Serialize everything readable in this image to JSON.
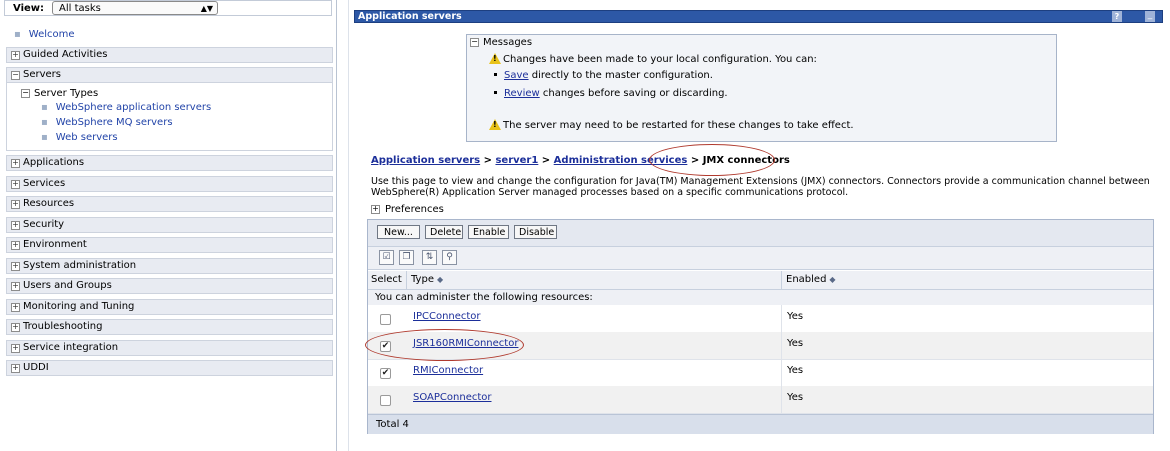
{
  "nav": {
    "view_label": "View:",
    "view_value": "All tasks",
    "welcome": "Welcome",
    "items": [
      {
        "label": "Guided Activities",
        "state": "+"
      },
      {
        "label": "Servers",
        "state": "−"
      },
      {
        "label": "Applications",
        "state": "+"
      },
      {
        "label": "Services",
        "state": "+"
      },
      {
        "label": "Resources",
        "state": "+"
      },
      {
        "label": "Security",
        "state": "+"
      },
      {
        "label": "Environment",
        "state": "+"
      },
      {
        "label": "System administration",
        "state": "+"
      },
      {
        "label": "Users and Groups",
        "state": "+"
      },
      {
        "label": "Monitoring and Tuning",
        "state": "+"
      },
      {
        "label": "Troubleshooting",
        "state": "+"
      },
      {
        "label": "Service integration",
        "state": "+"
      },
      {
        "label": "UDDI",
        "state": "+"
      }
    ],
    "server_types": {
      "label": "Server Types",
      "links": [
        "WebSphere application servers",
        "WebSphere MQ servers",
        "Web servers"
      ]
    }
  },
  "panel": {
    "title": "Application servers",
    "help": "?",
    "messages": {
      "header": "Messages",
      "line1": "Changes have been made to your local configuration. You can:",
      "save_link": "Save",
      "save_rest": " directly to the master configuration.",
      "review_link": "Review",
      "review_rest": " changes before saving or discarding.",
      "restart": "The server may need to be restarted for these changes to take effect."
    },
    "breadcrumb": {
      "c1": "Application servers",
      "c2": "server1",
      "c3": "Administration services",
      "c4": "JMX connectors",
      "sep": " > "
    },
    "description": "Use this page to view and change the configuration for Java(TM) Management Extensions (JMX) connectors. Connectors provide a communication channel between WebSphere(R) Application Server managed processes based on a specific communications protocol.",
    "preferences": "Preferences",
    "buttons": {
      "new": "New...",
      "delete": "Delete",
      "enable": "Enable",
      "disable": "Disable"
    },
    "table": {
      "col_select": "Select",
      "col_type": "Type",
      "col_enabled": "Enabled",
      "info": "You can administer the following resources:",
      "rows": [
        {
          "type": "IPCConnector",
          "enabled": "Yes",
          "checked": false
        },
        {
          "type": "JSR160RMIConnector",
          "enabled": "Yes",
          "checked": true
        },
        {
          "type": "RMIConnector",
          "enabled": "Yes",
          "checked": true
        },
        {
          "type": "SOAPConnector",
          "enabled": "Yes",
          "checked": false
        }
      ],
      "total": "Total 4"
    }
  },
  "colors": {
    "title_bar": "#2d58a6",
    "link": "#1c2f9a",
    "annotation_oval": "#b03a2e"
  }
}
